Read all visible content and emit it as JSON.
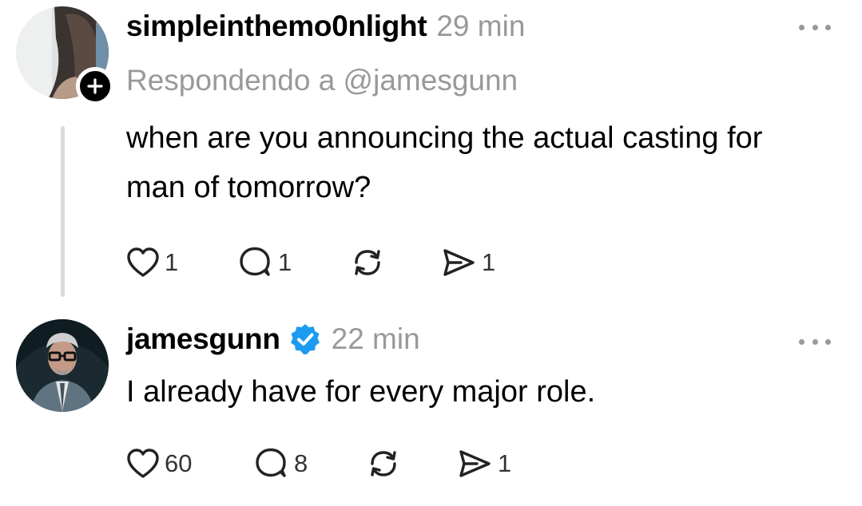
{
  "posts": [
    {
      "username": "simpleinthemo0nlight",
      "time": "29 min",
      "reply_to": "Respondendo a @jamesgunn",
      "text": "when are you announcing the actual casting for man of tomorrow?",
      "likes": "1",
      "comments": "1",
      "shares": "1",
      "avatar": "user-avatar-photo",
      "badge_icon": "follow-plus-icon"
    },
    {
      "username": "jamesgunn",
      "verified": true,
      "time": "22 min",
      "text": "I already have for every major role.",
      "likes": "60",
      "comments": "8",
      "shares": "1",
      "avatar": "user-avatar-photo"
    }
  ],
  "icons": {
    "like": "heart-icon",
    "comment": "comment-bubble-icon",
    "repost": "repost-icon",
    "share": "send-icon",
    "more": "more-dots-icon",
    "verified": "verified-badge-icon"
  },
  "colors": {
    "verified": "#1d9bf0",
    "muted": "#999999",
    "thread_line": "#dadada"
  }
}
